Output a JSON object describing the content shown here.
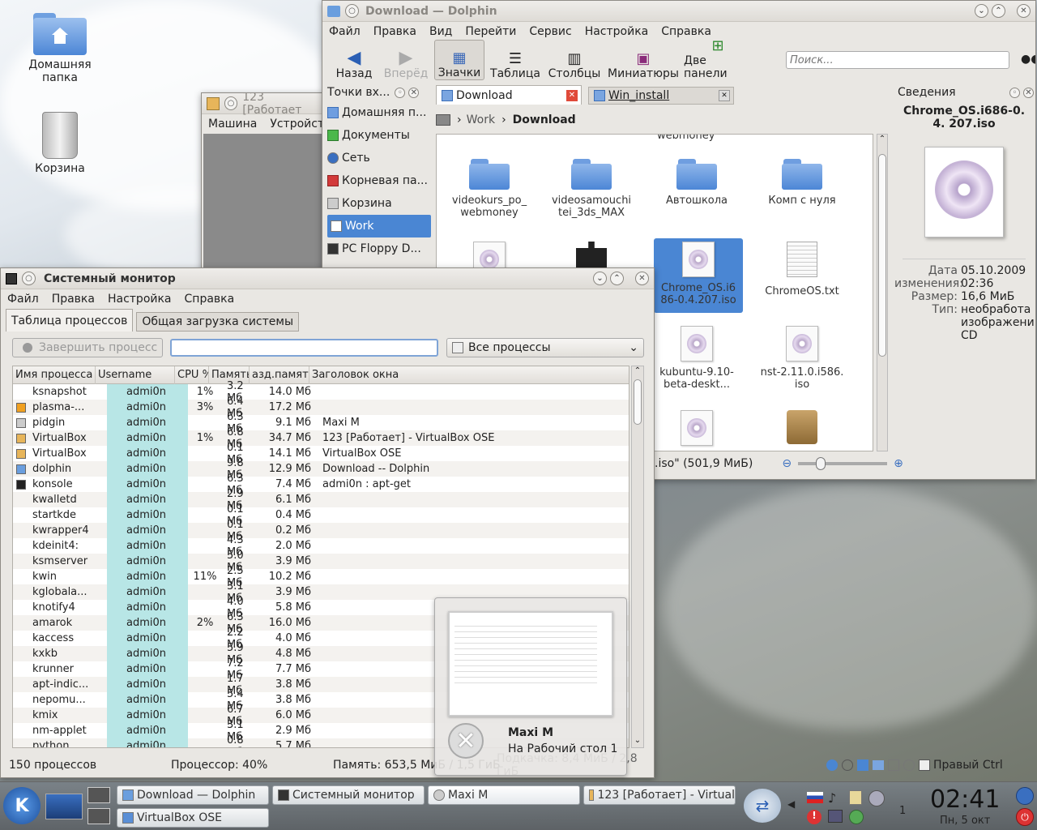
{
  "desktop": {
    "icons": [
      {
        "label": "Домашняя папка",
        "icon": "home-folder-icon"
      },
      {
        "label": "Корзина",
        "icon": "trash-icon"
      }
    ]
  },
  "dolphin": {
    "title": "Download — Dolphin",
    "menu": [
      "Файл",
      "Правка",
      "Вид",
      "Перейти",
      "Сервис",
      "Настройка",
      "Справка"
    ],
    "toolbar": {
      "back": "Назад",
      "forward": "Вперёд",
      "icons": "Значки",
      "table": "Таблица",
      "columns": "Столбцы",
      "previews": "Миниатюры",
      "split": "Две панели"
    },
    "search_placeholder": "Поиск...",
    "places": {
      "title": "Точки вх...",
      "items": [
        "Домашняя п...",
        "Документы",
        "Сеть",
        "Корневая па...",
        "Корзина",
        "Work",
        "PC Floppy D..."
      ]
    },
    "tabs": [
      "Download",
      "Win_install"
    ],
    "breadcrumb": [
      "Work",
      "Download"
    ],
    "files": {
      "top_cut": "webmoney",
      "row1": [
        "videokurs_po_ webmoney",
        "videosamouchi tei_3ds_MAX",
        "Автошкола",
        "Комп с нуля"
      ],
      "row2": [
        "",
        "",
        "Chrome_OS.i6 86-0.4.207.iso",
        "ChromeOS.txt"
      ],
      "row3": [
        "kubuntu-9.10- beta-deskt...",
        "nst-2.11.0.i586. iso"
      ]
    },
    "status": ".iso\" (501,9 МиБ)",
    "info": {
      "title": "Сведения",
      "filename": "Chrome_OS.i686-0.4. 207.iso",
      "rows": [
        {
          "k": "Дата",
          "v": "05.10.2009"
        },
        {
          "k": "изменения:",
          "v": "02:36"
        },
        {
          "k": "Размер:",
          "v": "16,6 МиБ"
        },
        {
          "k": "Тип:",
          "v": "необработа изображени CD"
        }
      ]
    }
  },
  "vbox": {
    "title": "123 [Работает",
    "menu": [
      "Машина",
      "Устройст"
    ]
  },
  "sysmon": {
    "title": "Системный монитор",
    "menu": [
      "Файл",
      "Правка",
      "Настройка",
      "Справка"
    ],
    "tabs": [
      "Таблица процессов",
      "Общая загрузка системы"
    ],
    "kill_button": "Завершить процесс",
    "filter": "Все процессы",
    "columns": [
      "Имя процесса",
      "Username",
      "CPU %",
      "Память",
      "азд.памят",
      "Заголовок окна"
    ],
    "rows": [
      {
        "name": "ksnapshot",
        "user": "admi0n",
        "cpu": "1%",
        "mem": "3.2 Мб",
        "shm": "14.0 Мб",
        "title": ""
      },
      {
        "name": "plasma-...",
        "user": "admi0n",
        "cpu": "3%",
        "mem": "6.4 Мб",
        "shm": "17.2 Мб",
        "title": ""
      },
      {
        "name": "pidgin",
        "user": "admi0n",
        "cpu": "",
        "mem": "6.3 Мб",
        "shm": "9.1 Мб",
        "title": "Maxi M"
      },
      {
        "name": "VirtualBox",
        "user": "admi0n",
        "cpu": "1%",
        "mem": "6.8 Мб",
        "shm": "34.7 Мб",
        "title": "123 [Работает] - VirtualBox OSE"
      },
      {
        "name": "VirtualBox",
        "user": "admi0n",
        "cpu": "",
        "mem": "0.1 Мб",
        "shm": "14.1 Мб",
        "title": "VirtualBox OSE"
      },
      {
        "name": "dolphin",
        "user": "admi0n",
        "cpu": "",
        "mem": "9.8 Мб",
        "shm": "12.9 Мб",
        "title": "Download -- Dolphin"
      },
      {
        "name": "konsole",
        "user": "admi0n",
        "cpu": "",
        "mem": "6.3 Мб",
        "shm": "7.4 Мб",
        "title": "admi0n : apt-get"
      },
      {
        "name": "kwalletd",
        "user": "admi0n",
        "cpu": "",
        "mem": "2.9 Мб",
        "shm": "6.1 Мб",
        "title": ""
      },
      {
        "name": "startkde",
        "user": "admi0n",
        "cpu": "",
        "mem": "0.1 Мб",
        "shm": "0.4 Мб",
        "title": ""
      },
      {
        "name": "kwrapper4",
        "user": "admi0n",
        "cpu": "",
        "mem": "0.1 Мб",
        "shm": "0.2 Мб",
        "title": ""
      },
      {
        "name": "kdeinit4:",
        "user": "admi0n",
        "cpu": "",
        "mem": "4.3 Мб",
        "shm": "2.0 Мб",
        "title": ""
      },
      {
        "name": "ksmserver",
        "user": "admi0n",
        "cpu": "",
        "mem": "5.0 Мб",
        "shm": "3.9 Мб",
        "title": ""
      },
      {
        "name": "kwin",
        "user": "admi0n",
        "cpu": "11%",
        "mem": "2.5 Мб",
        "shm": "10.2 Мб",
        "title": ""
      },
      {
        "name": "kglobala...",
        "user": "admi0n",
        "cpu": "",
        "mem": "3.1 Мб",
        "shm": "3.9 Мб",
        "title": ""
      },
      {
        "name": "knotify4",
        "user": "admi0n",
        "cpu": "",
        "mem": "4.0 Мб",
        "shm": "5.8 Мб",
        "title": ""
      },
      {
        "name": "amarok",
        "user": "admi0n",
        "cpu": "2%",
        "mem": "6.3 Мб",
        "shm": "16.0 Мб",
        "title": ""
      },
      {
        "name": "kaccess",
        "user": "admi0n",
        "cpu": "",
        "mem": "2.2 Мб",
        "shm": "4.0 Мб",
        "title": ""
      },
      {
        "name": "kxkb",
        "user": "admi0n",
        "cpu": "",
        "mem": "5.9 Мб",
        "shm": "4.8 Мб",
        "title": ""
      },
      {
        "name": "krunner",
        "user": "admi0n",
        "cpu": "",
        "mem": "7.2 Мб",
        "shm": "7.7 Мб",
        "title": ""
      },
      {
        "name": "apt-indic...",
        "user": "admi0n",
        "cpu": "",
        "mem": "1.7 Мб",
        "shm": "3.8 Мб",
        "title": ""
      },
      {
        "name": "nepomu...",
        "user": "admi0n",
        "cpu": "",
        "mem": "5.4 Мб",
        "shm": "3.8 Мб",
        "title": ""
      },
      {
        "name": "kmix",
        "user": "admi0n",
        "cpu": "",
        "mem": "6.7 Мб",
        "shm": "6.0 Мб",
        "title": ""
      },
      {
        "name": "nm-applet",
        "user": "admi0n",
        "cpu": "",
        "mem": "3.1 Мб",
        "shm": "2.9 Мб",
        "title": ""
      },
      {
        "name": "python",
        "user": "admi0n",
        "cpu": "",
        "mem": "0.8 Мб",
        "shm": "5.7 Мб",
        "title": ""
      }
    ],
    "status": {
      "count": "150 процессов",
      "cpu": "Процессор: 40%",
      "mem": "Память: 653,5 МиБ / 1,5 ГиБ",
      "swap": "Подкачка: 8,4 МиБ / 2,8 ГиБ"
    }
  },
  "notification": {
    "name": "Maxi M",
    "text": "На Рабочий стол 1"
  },
  "taskbar": {
    "tasks": [
      "Download — Dolphin",
      "Системный монитор",
      "Maxi M",
      "123 [Работает] - Virtual",
      "VirtualBox OSE"
    ],
    "tray_label": "Правый Ctrl",
    "desktop_num": "1",
    "clock": "02:41",
    "date": "Пн, 5 окт"
  }
}
